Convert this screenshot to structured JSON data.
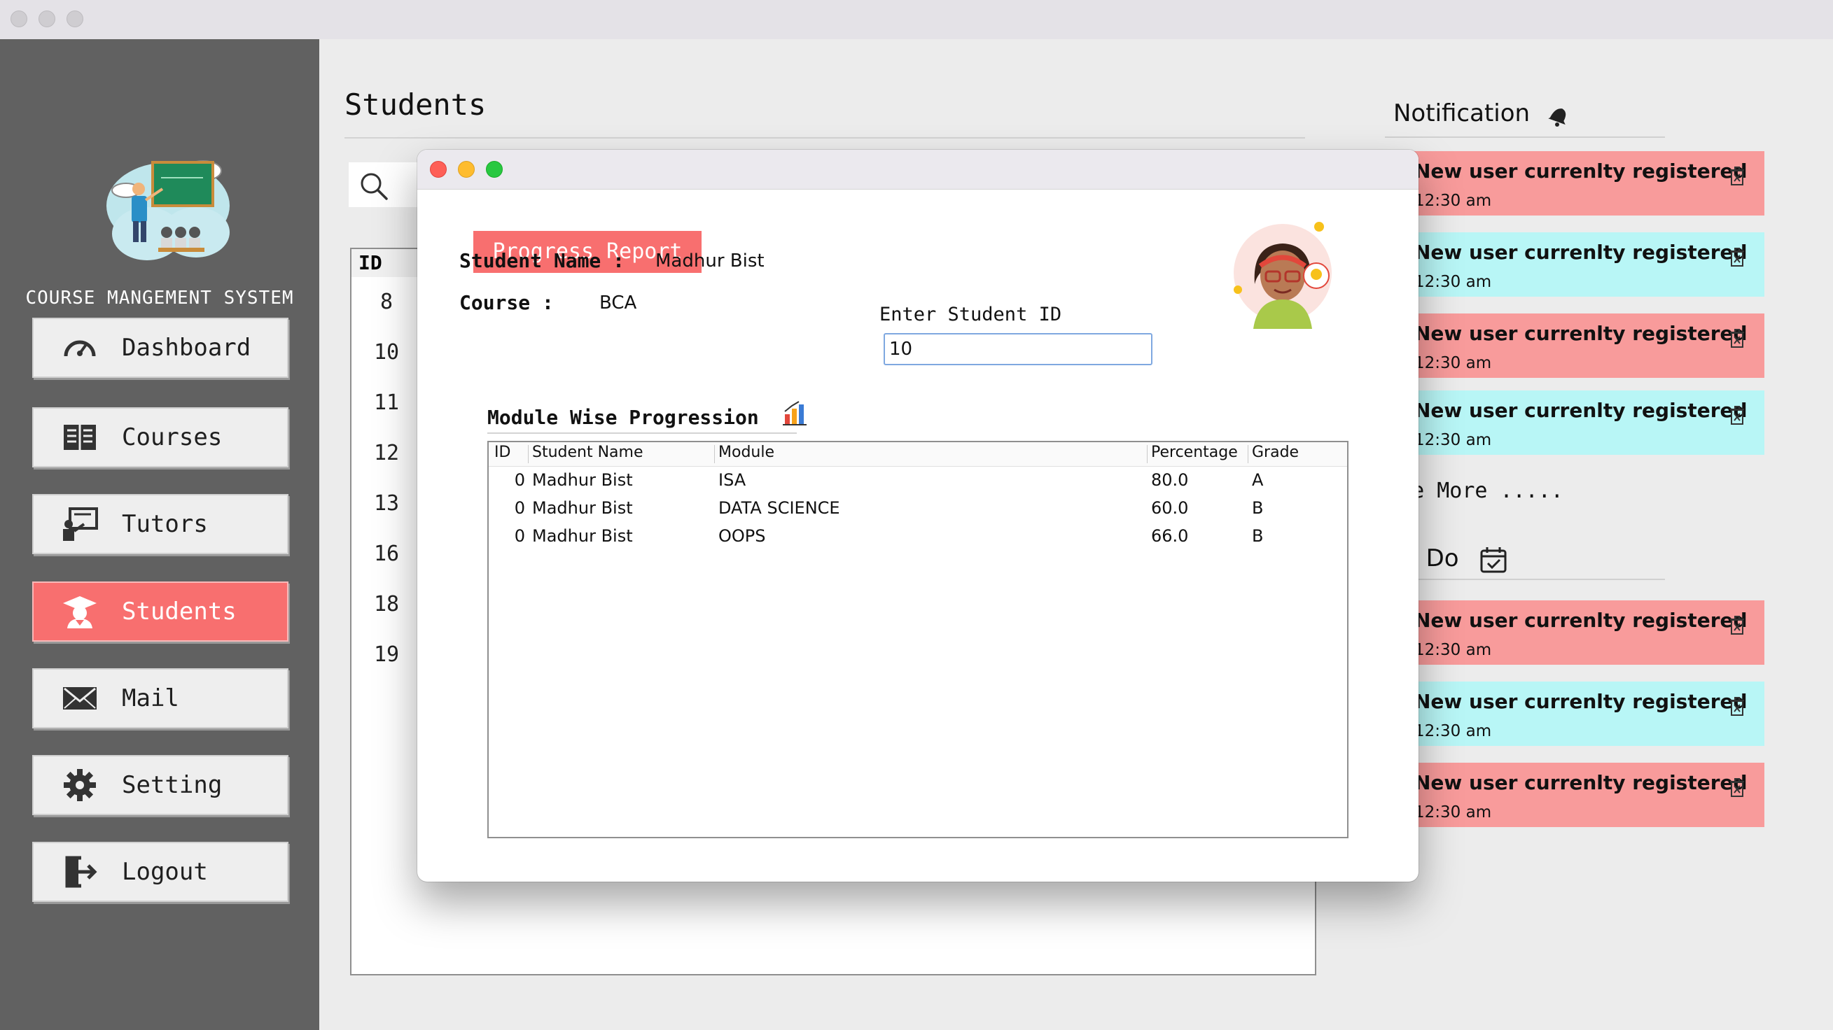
{
  "app": {
    "brand_title": "COURSE MANGEMENT SYSTEM"
  },
  "sidebar": {
    "items": [
      {
        "label": "Dashboard",
        "icon": "speedometer-icon",
        "active": false
      },
      {
        "label": "Courses",
        "icon": "book-icon",
        "active": false
      },
      {
        "label": "Tutors",
        "icon": "tutor-board-icon",
        "active": false
      },
      {
        "label": "Students",
        "icon": "graduate-icon",
        "active": true
      },
      {
        "label": "Mail",
        "icon": "mail-icon",
        "active": false
      },
      {
        "label": "Setting",
        "icon": "gear-icon",
        "active": false
      },
      {
        "label": "Logout",
        "icon": "logout-icon",
        "active": false
      }
    ]
  },
  "main": {
    "title": "Students",
    "table_header": "ID",
    "ids": [
      "8",
      "10",
      "11",
      "12",
      "13",
      "16",
      "18",
      "19"
    ]
  },
  "notifications": {
    "title": "Notification",
    "items": [
      {
        "text": "New user currenlty registered",
        "time": "12:30 am",
        "color": "#f89b9b"
      },
      {
        "text": "New user currenlty registered",
        "time": "12:30 am",
        "color": "#b8f6f6"
      },
      {
        "text": "New user currenlty registered",
        "time": "12:30 am",
        "color": "#f89b9b"
      },
      {
        "text": "New user currenlty registered",
        "time": "12:30 am",
        "color": "#b8f6f6"
      }
    ],
    "see_more": "See More ....."
  },
  "todo": {
    "title": "To Do",
    "items": [
      {
        "text": "New user currenlty registered",
        "time": "12:30 am",
        "color": "#f89b9b"
      },
      {
        "text": "New user currenlty registered",
        "time": "12:30 am",
        "color": "#b8f6f6"
      },
      {
        "text": "New user currenlty registered",
        "time": "12:30 am",
        "color": "#f89b9b"
      }
    ]
  },
  "modal": {
    "badge": "Progress Report",
    "student_name_label": "Student Name :",
    "student_name": "Madhur Bist",
    "course_label": "Course :",
    "course": "BCA",
    "enter_id_label": "Enter Student ID",
    "student_id_value": "10",
    "progression_title": "Module Wise Progression",
    "columns": [
      "ID",
      "Student Name",
      "Module",
      "Percentage",
      "Grade"
    ],
    "rows": [
      [
        "0",
        "Madhur Bist",
        "ISA",
        "80.0",
        "A"
      ],
      [
        "0",
        "Madhur Bist",
        "DATA SCIENCE",
        "60.0",
        "B"
      ],
      [
        "0",
        "Madhur Bist",
        "OOPS",
        "66.0",
        "B"
      ]
    ]
  },
  "colors": {
    "accent": "#f86f6f",
    "sidebar": "#616161",
    "notif_red": "#f89b9b",
    "notif_cyan": "#b8f6f6"
  }
}
